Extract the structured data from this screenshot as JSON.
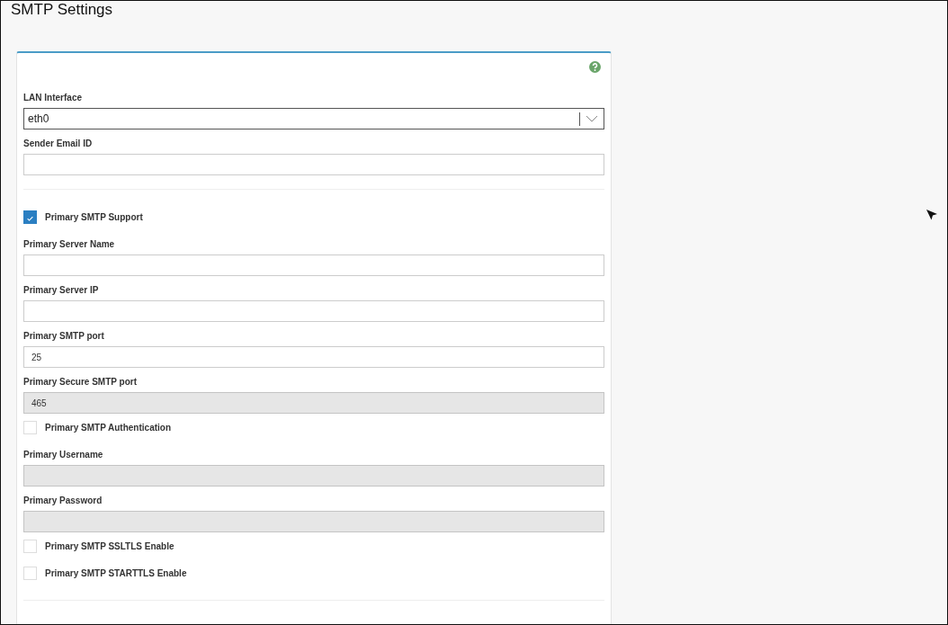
{
  "title": "SMTP Settings",
  "fields": [
    {
      "kind": "select",
      "label": "LAN Interface",
      "value": "eth0"
    },
    {
      "kind": "text",
      "label": "Sender Email ID",
      "disabled": false
    },
    {
      "kind": "divider"
    },
    {
      "kind": "checkbox",
      "label": "Primary SMTP Support",
      "checked": true
    },
    {
      "kind": "text",
      "label": "Primary Server Name",
      "disabled": false
    },
    {
      "kind": "text",
      "label": "Primary Server IP",
      "disabled": false
    },
    {
      "kind": "text",
      "label": "Primary SMTP port",
      "value": "25",
      "disabled": false
    },
    {
      "kind": "text",
      "label": "Primary Secure SMTP port",
      "value": "465",
      "disabled": true
    },
    {
      "kind": "checkbox",
      "label": "Primary SMTP Authentication",
      "checked": false
    },
    {
      "kind": "text",
      "label": "Primary Username",
      "disabled": true
    },
    {
      "kind": "text",
      "label": "Primary Password",
      "disabled": true
    },
    {
      "kind": "checkbox",
      "label": "Primary SMTP SSLTLS Enable",
      "checked": false
    },
    {
      "kind": "checkbox",
      "label": "Primary SMTP STARTTLS Enable",
      "checked": false
    },
    {
      "kind": "divider"
    }
  ]
}
